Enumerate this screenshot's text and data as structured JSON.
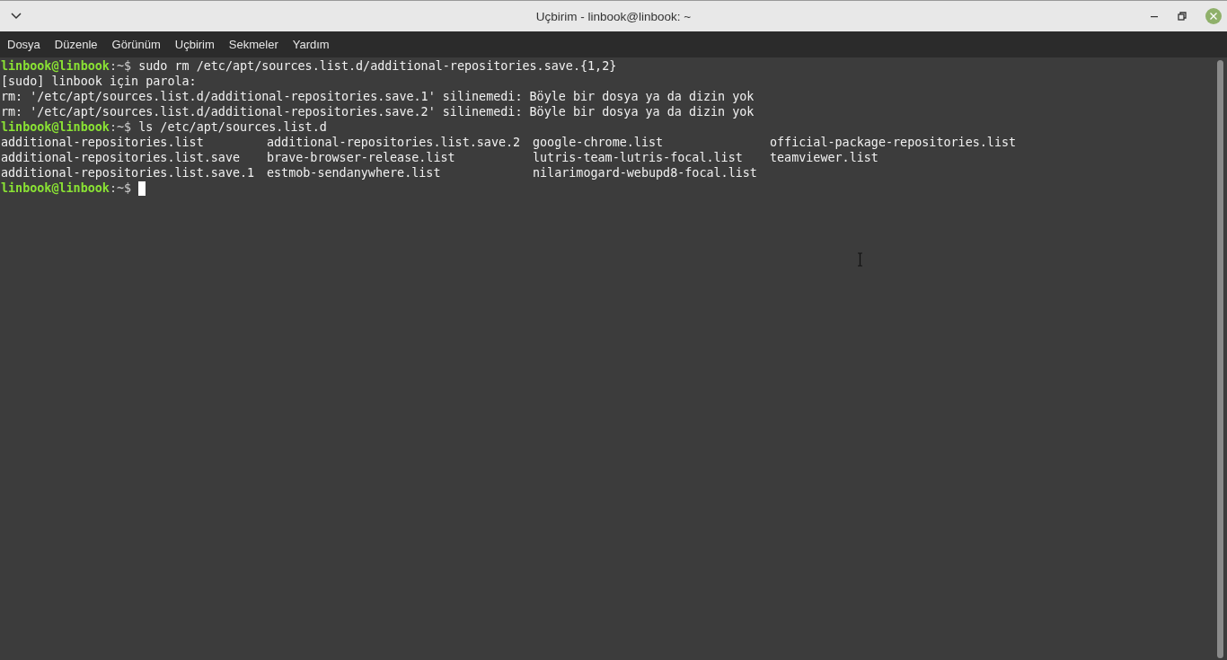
{
  "window": {
    "title": "Uçbirim - linbook@linbook: ~"
  },
  "menu": [
    "Dosya",
    "Düzenle",
    "Görünüm",
    "Uçbirim",
    "Sekmeler",
    "Yardım"
  ],
  "terminal": {
    "lines": [
      {
        "kind": "prompt",
        "user": "linbook@linbook",
        "path": ":~$",
        "command": "sudo rm /etc/apt/sources.list.d/additional-repositories.save.{1,2}",
        "cursor": false
      },
      {
        "kind": "output",
        "text": "[sudo] linbook için parola:"
      },
      {
        "kind": "output",
        "text": "rm: '/etc/apt/sources.list.d/additional-repositories.save.1' silinemedi: Böyle bir dosya ya da dizin yok"
      },
      {
        "kind": "output",
        "text": "rm: '/etc/apt/sources.list.d/additional-repositories.save.2' silinemedi: Böyle bir dosya ya da dizin yok"
      },
      {
        "kind": "prompt",
        "user": "linbook@linbook",
        "path": ":~$",
        "command": "ls /etc/apt/sources.list.d",
        "cursor": false
      },
      {
        "kind": "listing",
        "rows": [
          [
            "additional-repositories.list",
            "additional-repositories.list.save.2",
            "google-chrome.list",
            "official-package-repositories.list"
          ],
          [
            "additional-repositories.list.save",
            "brave-browser-release.list",
            "lutris-team-lutris-focal.list",
            "teamviewer.list"
          ],
          [
            "additional-repositories.list.save.1",
            "estmob-sendanywhere.list",
            "nilarimogard-webupd8-focal.list"
          ]
        ]
      },
      {
        "kind": "prompt",
        "user": "linbook@linbook",
        "path": ":~$",
        "cursor": true
      }
    ]
  }
}
